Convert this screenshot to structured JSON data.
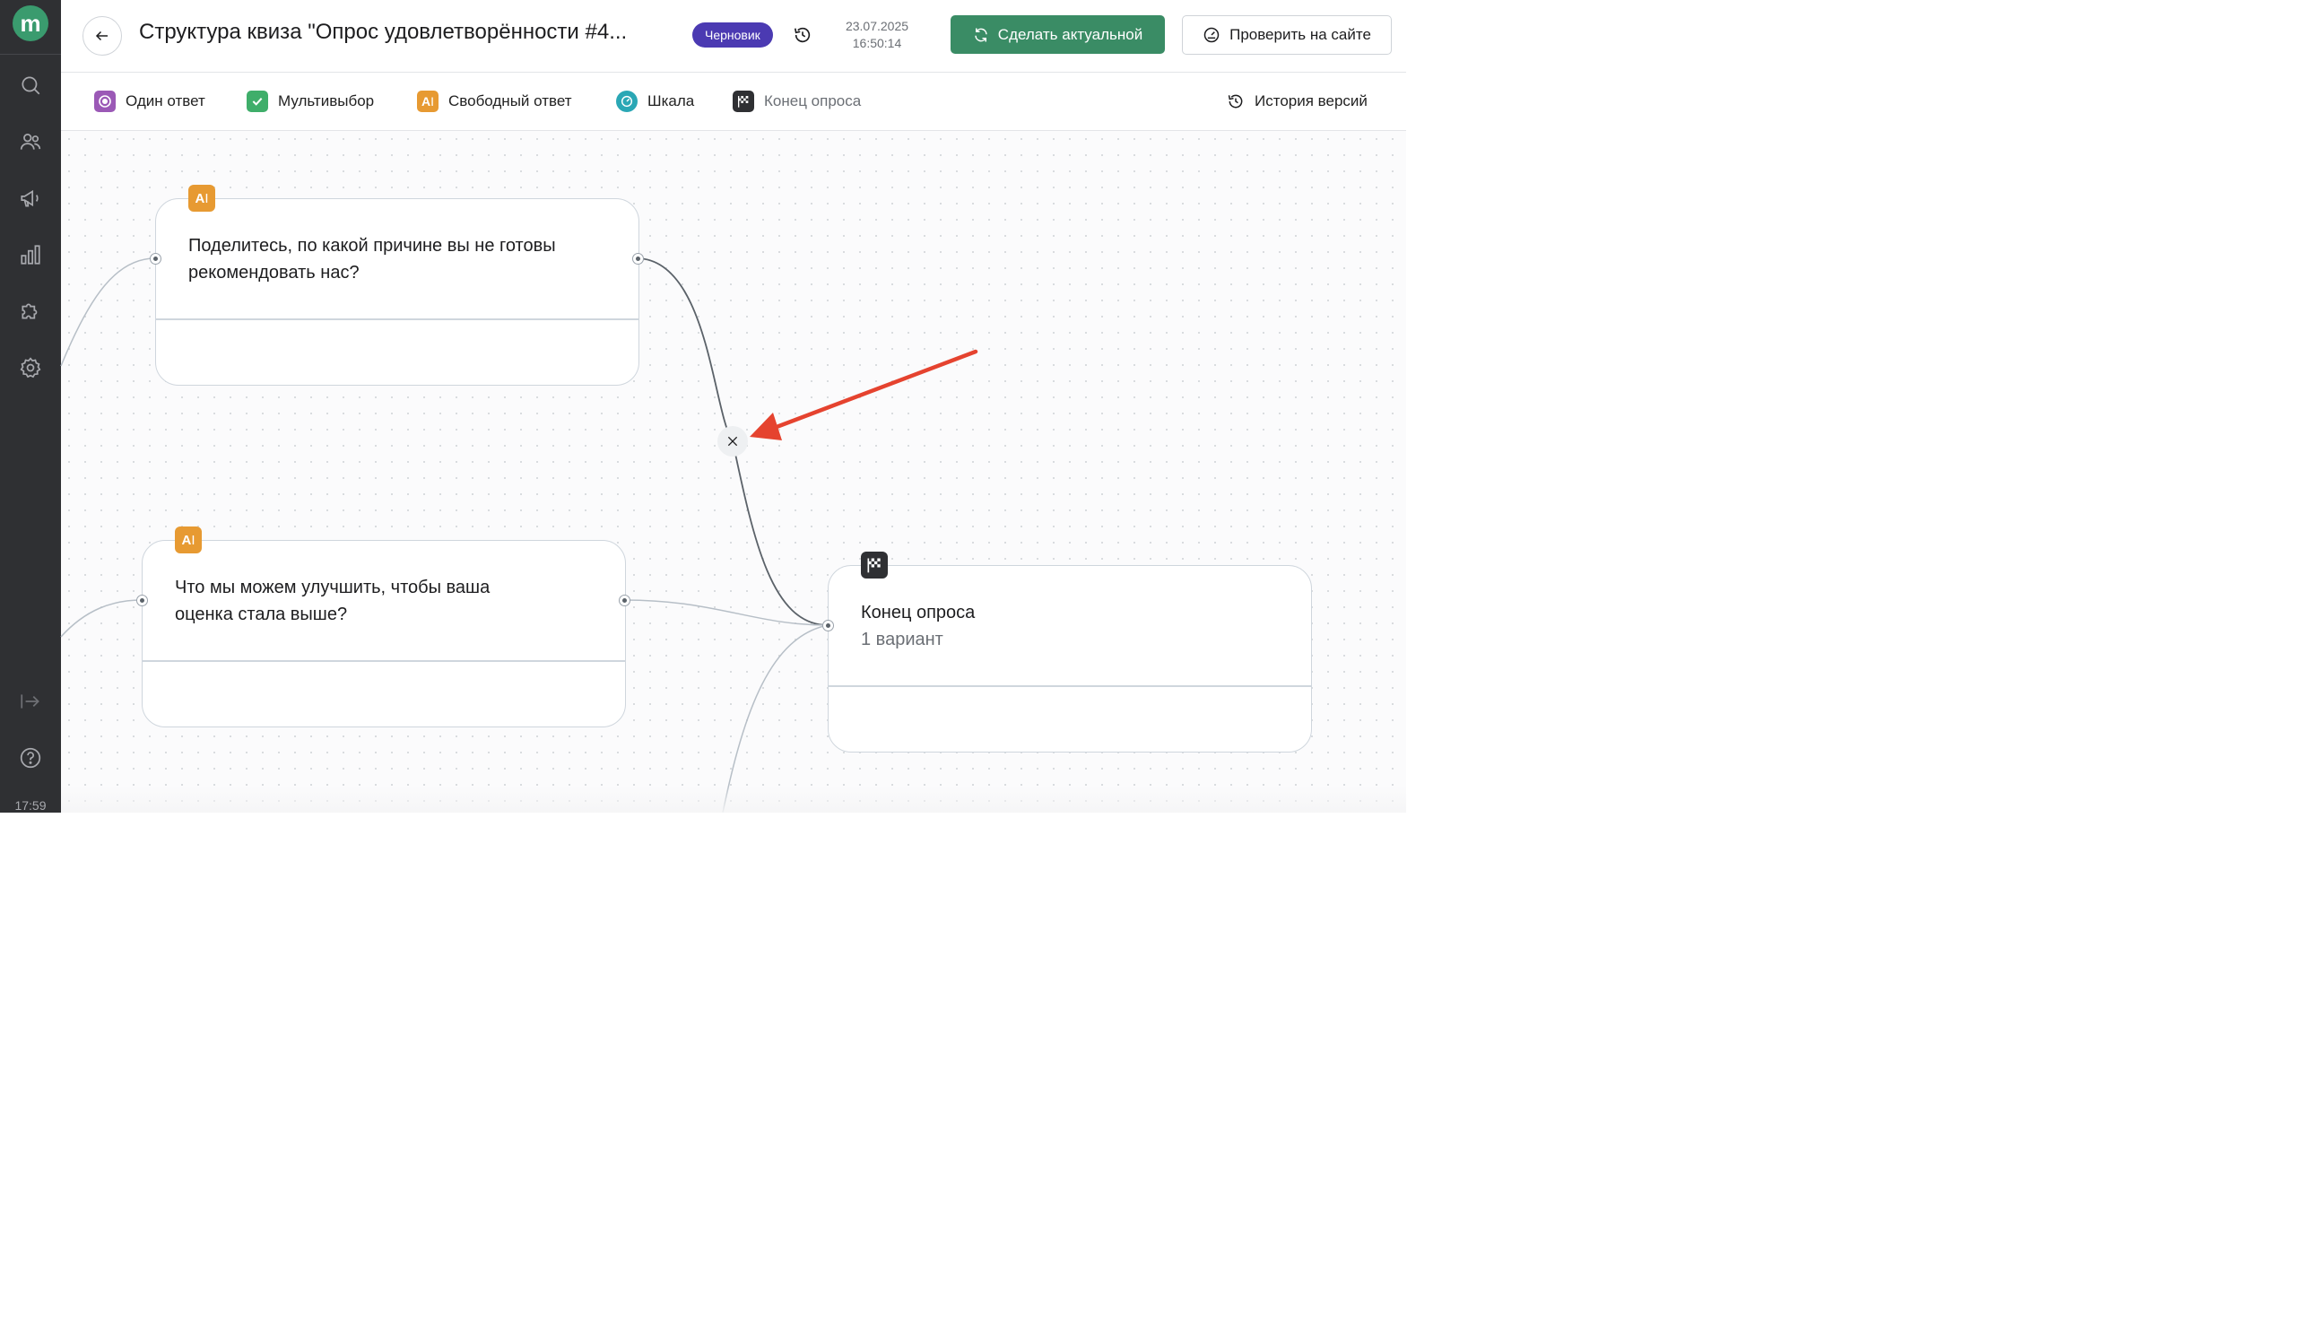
{
  "sidebar": {
    "logo_letter": "m",
    "time": "17:59",
    "icons": [
      "search-icon",
      "users-icon",
      "megaphone-icon",
      "analytics-icon",
      "puzzle-icon",
      "settings-icon",
      "collapse-icon",
      "help-icon"
    ]
  },
  "header": {
    "title": "Структура квиза \"Опрос удовлетворённости #4...",
    "status_badge": "Черновик",
    "date": "23.07.2025",
    "time": "16:50:14",
    "primary_button": "Сделать актуальной",
    "secondary_button": "Проверить на сайте"
  },
  "toolbar": {
    "items": [
      {
        "label": "Один ответ",
        "icon": "single-choice-icon",
        "color": "#9b59b6"
      },
      {
        "label": "Мультивыбор",
        "icon": "multi-choice-icon",
        "color": "#3fae6a"
      },
      {
        "label": "Свободный ответ",
        "icon": "free-text-icon",
        "color": "#e79a32"
      },
      {
        "label": "Шкала",
        "icon": "scale-icon",
        "color": "#2aa7b5"
      },
      {
        "label": "Конец опроса",
        "icon": "finish-flag-icon",
        "color": "#2f3033"
      }
    ],
    "history_label": "История версий"
  },
  "canvas": {
    "nodes": [
      {
        "type": "free-text",
        "badge": "A",
        "question_line1": "Поделитесь, по какой причине вы не готовы",
        "question_line2": "рекомендовать нас?"
      },
      {
        "type": "free-text",
        "badge": "A",
        "question_line1": "Что мы можем улучшить, чтобы ваша",
        "question_line2": "оценка стала выше?"
      },
      {
        "type": "end",
        "title": "Конец опроса",
        "subtitle": "1 вариант"
      }
    ]
  },
  "colors": {
    "brand_green": "#3a8c65",
    "badge_purple": "#4b3ab2",
    "sidebar_bg": "#2f3033",
    "annotation_arrow": "#e5432f"
  }
}
